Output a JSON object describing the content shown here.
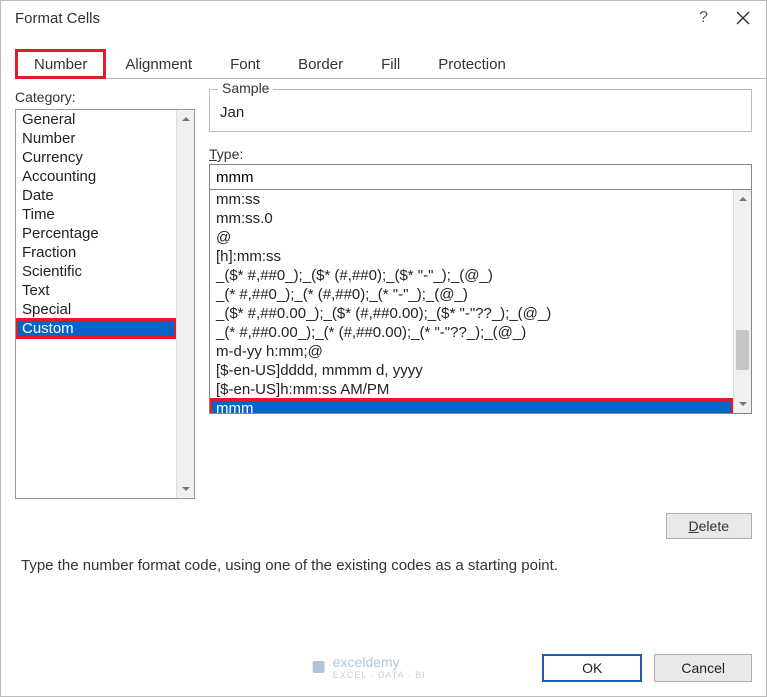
{
  "title": "Format Cells",
  "tabs": [
    "Number",
    "Alignment",
    "Font",
    "Border",
    "Fill",
    "Protection"
  ],
  "active_tab_index": 0,
  "category_label": "Category:",
  "categories": [
    "General",
    "Number",
    "Currency",
    "Accounting",
    "Date",
    "Time",
    "Percentage",
    "Fraction",
    "Scientific",
    "Text",
    "Special",
    "Custom"
  ],
  "selected_category_index": 11,
  "sample_label": "Sample",
  "sample_value": "Jan",
  "type_label": "Type:",
  "type_value": "mmm",
  "type_items": [
    "mm:ss",
    "mm:ss.0",
    "@",
    "[h]:mm:ss",
    "_($* #,##0_);_($* (#,##0);_($* \"-\"_);_(@_)",
    "_(* #,##0_);_(* (#,##0);_(* \"-\"_);_(@_)",
    "_($* #,##0.00_);_($* (#,##0.00);_($* \"-\"??_);_(@_)",
    "_(* #,##0.00_);_(* (#,##0.00);_(* \"-\"??_);_(@_)",
    "m-d-yy h:mm;@",
    "[$-en-US]dddd, mmmm d, yyyy",
    "[$-en-US]h:mm:ss AM/PM",
    "mmm"
  ],
  "selected_type_index": 11,
  "delete_label": "Delete",
  "hint_text": "Type the number format code, using one of the existing codes as a starting point.",
  "ok_label": "OK",
  "cancel_label": "Cancel",
  "watermark": {
    "brand": "exceldemy",
    "sub": "EXCEL · DATA · BI"
  }
}
